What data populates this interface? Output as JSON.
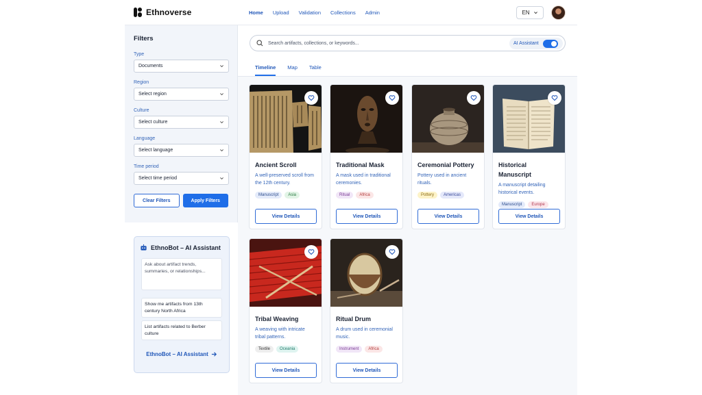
{
  "app": {
    "name": "Ethnoverse"
  },
  "nav": [
    "Home",
    "Upload",
    "Validation",
    "Collections",
    "Admin"
  ],
  "lang": "EN",
  "filters": {
    "title": "Filters",
    "fields": [
      {
        "label": "Type",
        "value": "Documents"
      },
      {
        "label": "Region",
        "value": "Select region"
      },
      {
        "label": "Culture",
        "value": "Select culture"
      },
      {
        "label": "Language",
        "value": "Select language"
      },
      {
        "label": "Time period",
        "value": "Select time period"
      }
    ],
    "clear_label": "Clear Filters",
    "apply_label": "Apply Filters"
  },
  "bot": {
    "title": "EthnoBot – AI Assistant",
    "ask_placeholder": "Ask about artifact trends, summaries, or relationships...",
    "suggestions": [
      "Show me artifacts from 13th century North Africa",
      "List artifacts related to Berber culture"
    ],
    "link_label": "EthnoBot – AI Assistant"
  },
  "search": {
    "placeholder": "Search artifacts, collections, or keywords...",
    "ai_label": "AI Assistant",
    "ai_enabled": true
  },
  "tabs": [
    "Timeline",
    "Map",
    "Table"
  ],
  "view_label": "View Details",
  "cards": [
    {
      "title": "Ancient Scroll",
      "desc": "A well-preserved scroll from the 12th century.",
      "tags": [
        {
          "t": "Manuscript",
          "bg": "#e4ebfa",
          "fg": "#2a4a8c"
        },
        {
          "t": "Asia",
          "bg": "#e2f4e6",
          "fg": "#2b7a43"
        }
      ]
    },
    {
      "title": "Traditional Mask",
      "desc": "A mask used in traditional ceremonies.",
      "tags": [
        {
          "t": "Ritual",
          "bg": "#f1e6f7",
          "fg": "#7a3a94"
        },
        {
          "t": "Africa",
          "bg": "#fbe6e6",
          "fg": "#b13a3a"
        }
      ]
    },
    {
      "title": "Ceremonial Pottery",
      "desc": "Pottery used in ancient rituals.",
      "tags": [
        {
          "t": "Pottery",
          "bg": "#fdf3c8",
          "fg": "#8a6a12"
        },
        {
          "t": "Americas",
          "bg": "#e4e8fa",
          "fg": "#3a4a9a"
        }
      ]
    },
    {
      "title": "Historical Manuscript",
      "desc": "A manuscript detailing historical events.",
      "tags": [
        {
          "t": "Manuscript",
          "bg": "#e4ebfa",
          "fg": "#2a4a8c"
        },
        {
          "t": "Europe",
          "bg": "#fbe6ea",
          "fg": "#b13a52"
        }
      ]
    },
    {
      "title": "Tribal Weaving",
      "desc": "A weaving with intricate tribal patterns.",
      "tags": [
        {
          "t": "Textile",
          "bg": "#eeeeee",
          "fg": "#333333"
        },
        {
          "t": "Oceania",
          "bg": "#dff4f0",
          "fg": "#207a6a"
        }
      ]
    },
    {
      "title": "Ritual Drum",
      "desc": "A drum used in ceremonial music.",
      "tags": [
        {
          "t": "Instrument",
          "bg": "#f1e6f7",
          "fg": "#7a3a94"
        },
        {
          "t": "Africa",
          "bg": "#fbe6e6",
          "fg": "#b13a3a"
        }
      ]
    }
  ]
}
